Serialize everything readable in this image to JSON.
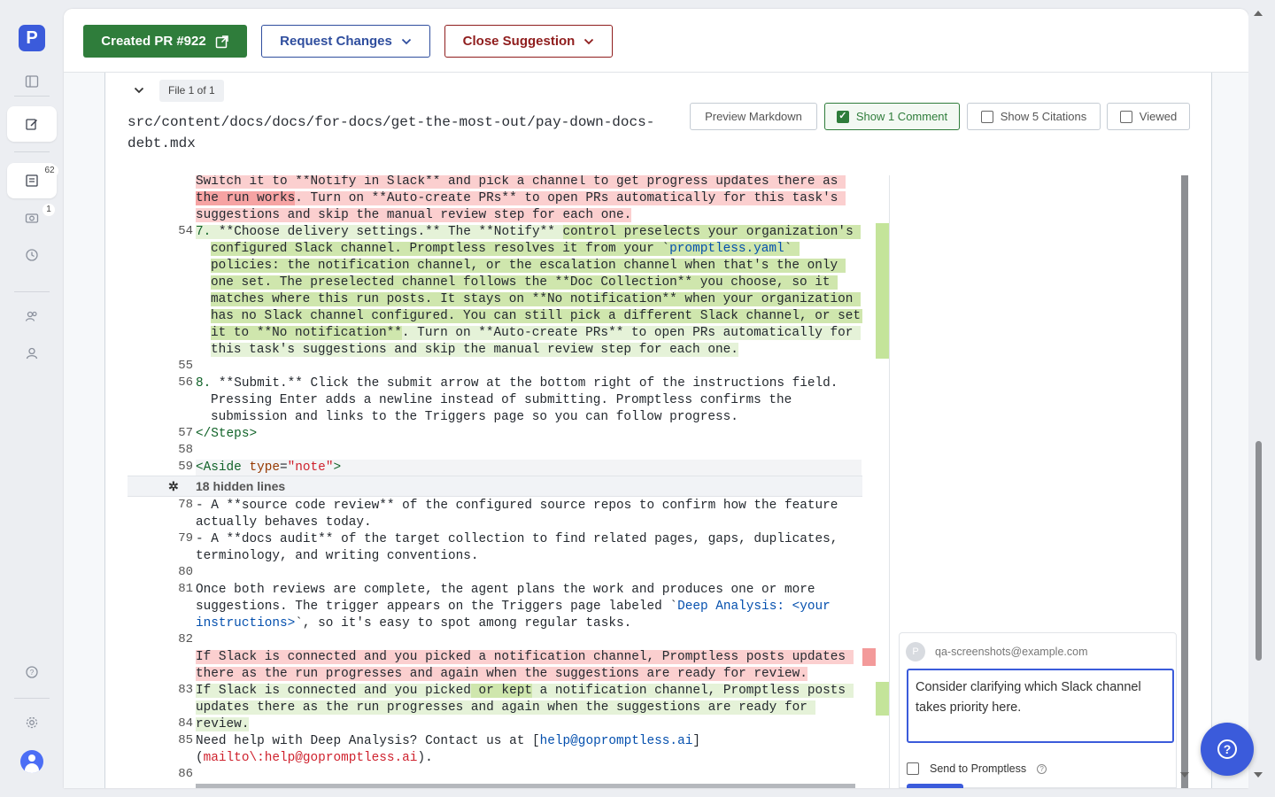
{
  "sidebar": {
    "logo": "P",
    "badges": {
      "suggestions": "62",
      "screenshots": "1"
    },
    "icons": [
      "panel-toggle-icon",
      "edit-icon",
      "suggestions-icon",
      "camera-icon",
      "history-icon",
      "team-icon",
      "user-icon",
      "help-icon",
      "settings-icon"
    ]
  },
  "toolbar": {
    "created_pr_label": "Created PR #922",
    "request_changes_label": "Request Changes",
    "close_suggestion_label": "Close Suggestion"
  },
  "file": {
    "collapse_glyph": "⌄",
    "badge": "File 1 of 1",
    "path": "src/content/docs/docs/for-docs/get-the-most-out/pay-down-docs-debt.mdx",
    "buttons": {
      "preview": "Preview Markdown",
      "show_comment": "Show 1 Comment",
      "show_citations": "Show 5 Citations",
      "viewed": "Viewed"
    },
    "show_comment_checked": true
  },
  "diff": {
    "hidden_lines_label": "18 hidden lines",
    "line_numbers": {
      "l54": "54",
      "l55": "55",
      "l56": "56",
      "l57": "57",
      "l58": "58",
      "l59": "59",
      "l78": "78",
      "l79": "79",
      "l80": "80",
      "l81": "81",
      "l82": "82",
      "l83": "83",
      "l84": "84",
      "l85": "85",
      "l86": "86"
    },
    "text": {
      "del1_a": "Switch it to **Notify in Slack** and pick a channel to get progress updates there as",
      "del1_b": "the run works",
      "del1_c": ". Turn on **Auto-create PRs** to open PRs automatically for this task's",
      "del1_d": "suggestions and skip the manual review step for each one.",
      "add54_num": "7. ",
      "add54_a": "**Choose delivery settings.** The **Notify** ",
      "add54_b": "control preselects your organization's configured Slack channel. Promptless resolves it from your `",
      "add54_link": "promptless.yaml",
      "add54_c": "` policies: the notification channel, or the escalation channel when that's the only one set. The preselected channel follows the **Doc Collection** you choose, so it matches where this run posts. It stays on **No notification** when your organization has no Slack channel configured. You can still pick a different Slack channel, or set it to **No notification**",
      "add54_d": ". Turn on **Auto-create PRs** to open PRs automatically for this task's suggestions and skip the manual review step for each one.",
      "l56_num": "8. ",
      "l56": "**Submit.** Click the submit arrow at the bottom right of the instructions field. Pressing Enter adds a newline instead of submitting. Promptless confirms the submission and links to the Triggers page so you can follow progress.",
      "l57": "</Steps>",
      "l59_tag_open": "<Aside ",
      "l59_attr": "type",
      "l59_eq": "=",
      "l59_val": "\"note\"",
      "l59_close": ">",
      "l78": "- A **source code review** of the configured source repos to confirm how the feature actually behaves today.",
      "l79": "- A **docs audit** of the target collection to find related pages, gaps, duplicates, terminology, and writing conventions.",
      "l81_a": "Once both reviews are complete, the agent plans the work and produces one or more suggestions. The trigger appears on the Triggers page labeled `",
      "l81_link": "Deep Analysis: <your instructions>",
      "l81_b": "`, so it's easy to spot among regular tasks.",
      "del83": "If Slack is connected and you picked a notification channel, Promptless posts updates there as the run progresses and again when the suggestions are ready for review.",
      "add83_a": "If Slack is connected and you picked",
      "add83_b": " or kept",
      "add83_c": " a notification channel, Promptless posts updates there as the run progresses and again when the suggestions are ready for review.",
      "l85_a": "Need help with Deep Analysis? Contact us at [",
      "l85_link": "help@gopromptless.ai",
      "l85_b": "](",
      "l85_mail": "mailto\\:help@gopromptless.ai",
      "l85_c": ")."
    }
  },
  "comment": {
    "avatar_letter": "P",
    "user": "qa-screenshots@example.com",
    "draft": "Consider clarifying which Slack channel takes priority here.",
    "send_label": "Send to Promptless",
    "send_checked": false
  },
  "help_fab": "?",
  "colors": {
    "primary": "#3b5bdb",
    "success": "#2f7d3b",
    "danger": "#8f1d1d",
    "added": "#e5f2d8",
    "deleted": "#fbcfcf"
  }
}
